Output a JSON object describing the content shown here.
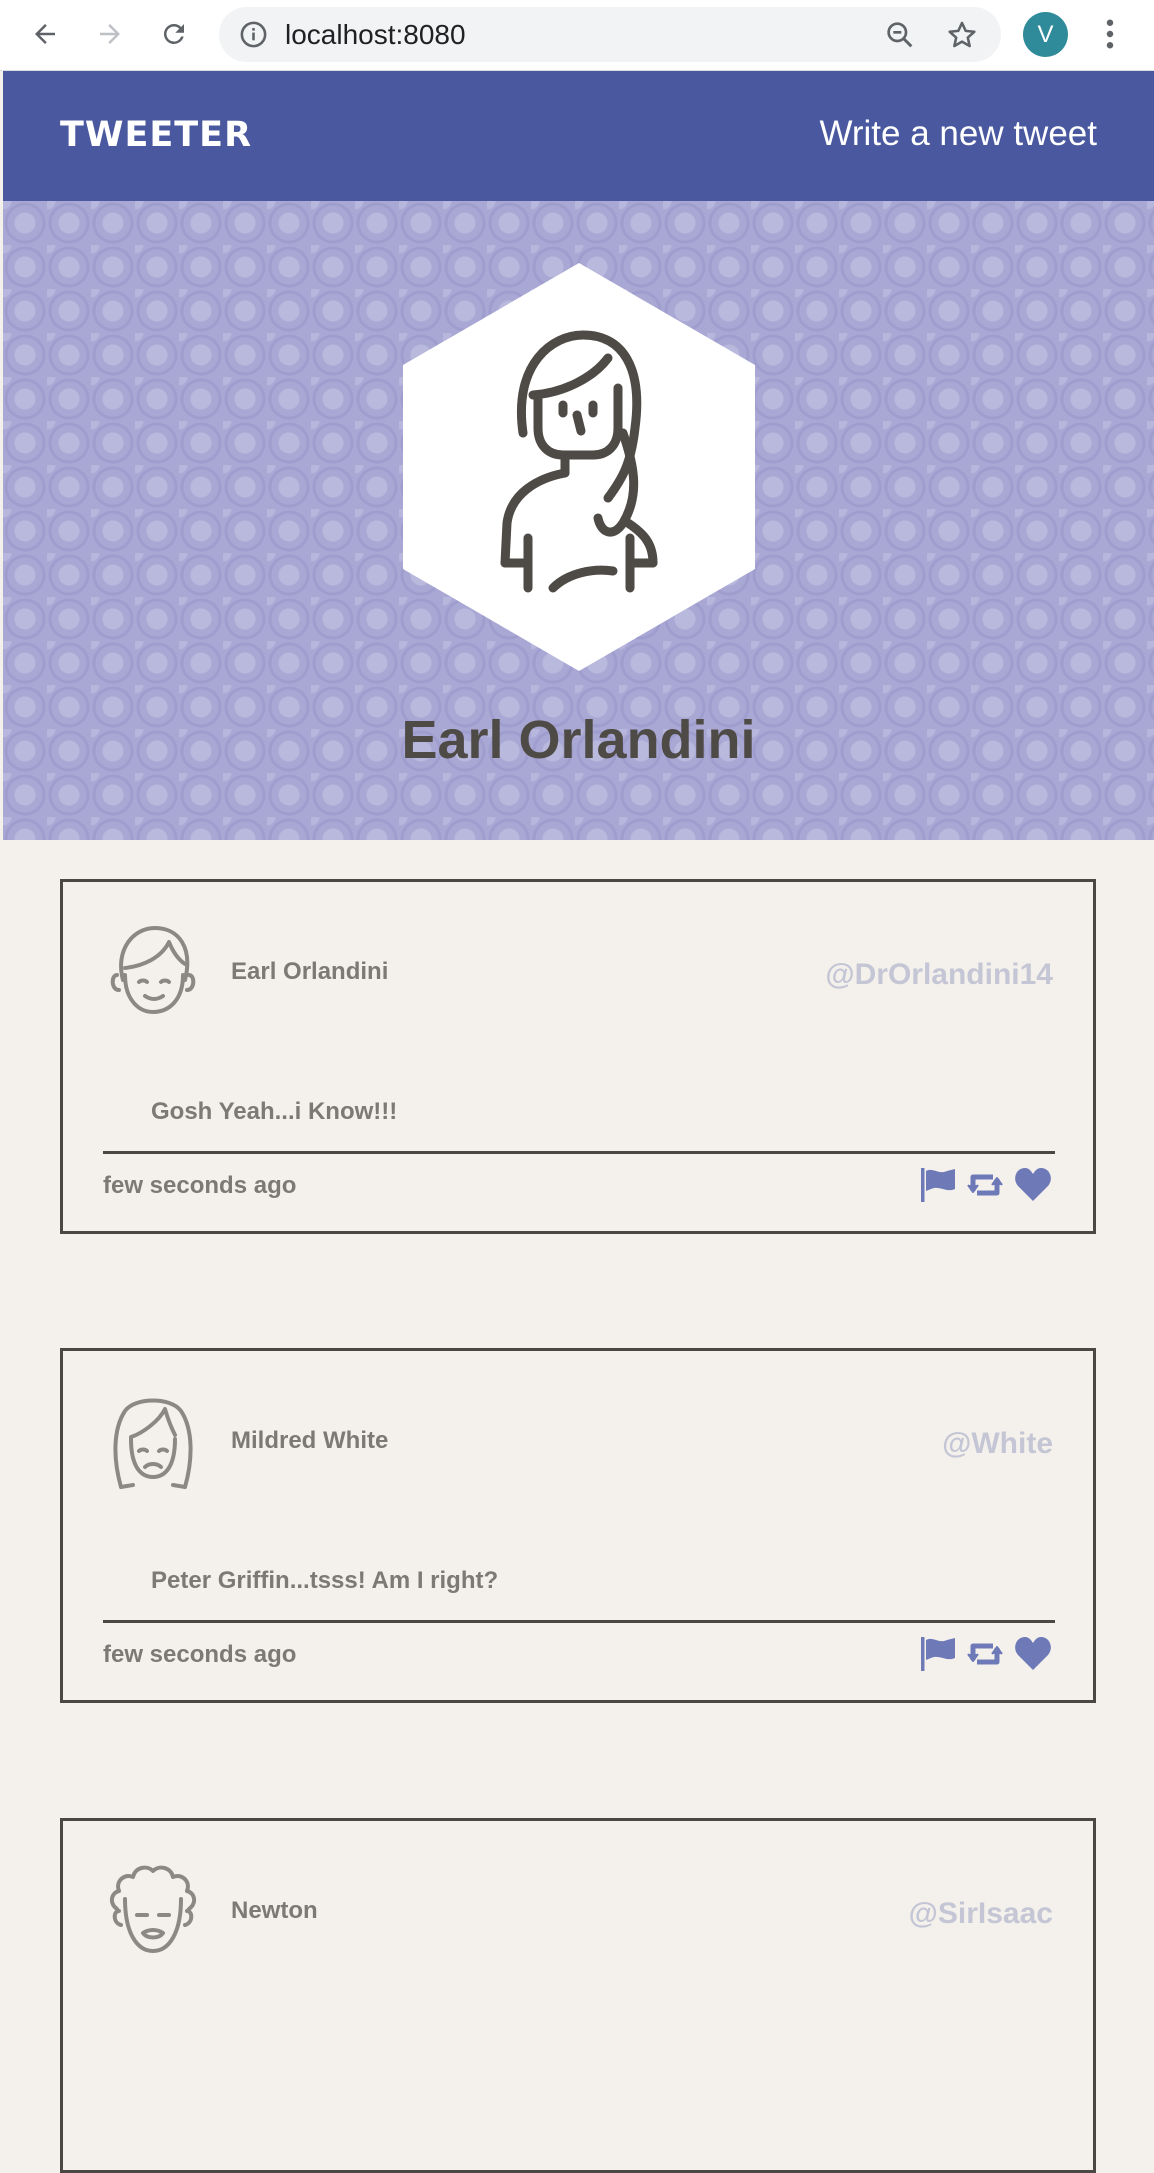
{
  "browser": {
    "url": "localhost:8080",
    "profile_initial": "V",
    "icons": [
      "back-arrow-icon",
      "forward-arrow-icon",
      "reload-icon",
      "info-icon",
      "zoom-out-icon",
      "star-icon",
      "more-vert-icon"
    ]
  },
  "nav": {
    "brand": "TWEETER",
    "compose_label": "Write a new tweet"
  },
  "profile": {
    "name": "Earl Orlandini"
  },
  "tweets": [
    {
      "name": "Earl Orlandini",
      "handle": "@DrOrlandini14",
      "content": "Gosh Yeah...i Know!!!",
      "timestamp": "few seconds ago"
    },
    {
      "name": "Mildred White",
      "handle": "@White",
      "content": "Peter Griffin...tsss! Am I right?",
      "timestamp": "few seconds ago"
    },
    {
      "name": "Newton",
      "handle": "@SirIsaac",
      "content": "",
      "timestamp": ""
    }
  ],
  "colors": {
    "nav_bg": "#4a599f",
    "header_bg": "#a9a8d5",
    "page_bg": "#f4f1ec",
    "action_icon": "#6e7ab7"
  }
}
